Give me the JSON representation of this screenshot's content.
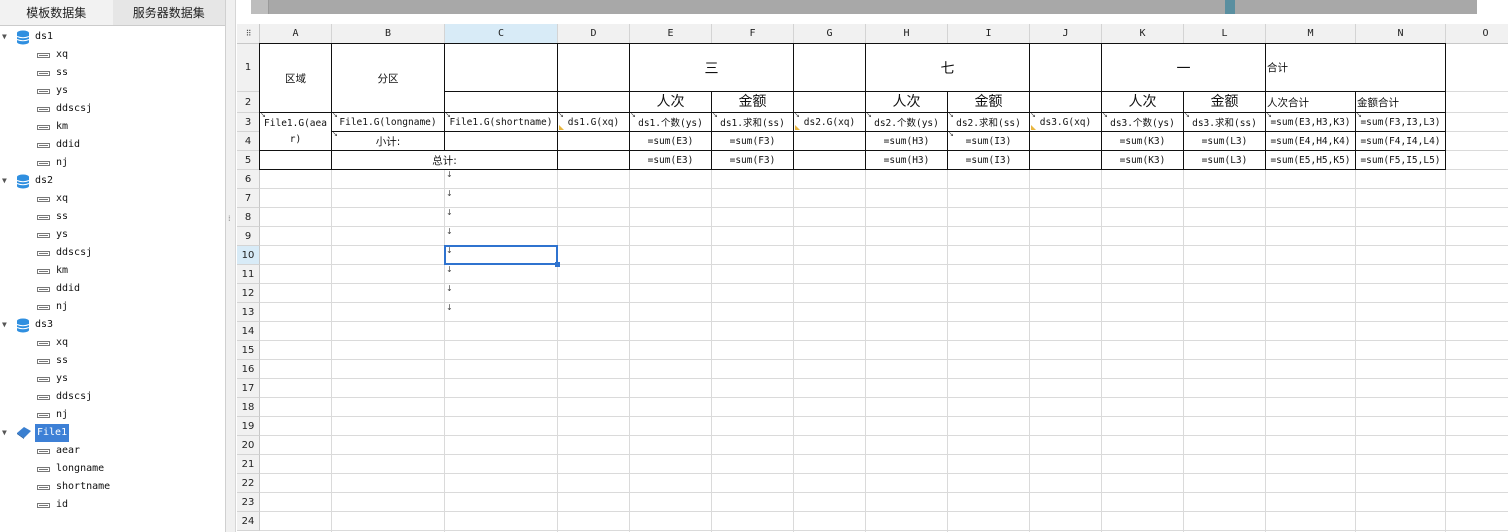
{
  "tabs": {
    "template": "模板数据集",
    "server": "服务器数据集"
  },
  "tree": [
    {
      "name": "ds1",
      "icon": "database-icon",
      "fields": [
        "xq",
        "ss",
        "ys",
        "ddscsj",
        "km",
        "ddid",
        "nj"
      ]
    },
    {
      "name": "ds2",
      "icon": "database-icon",
      "fields": [
        "xq",
        "ss",
        "ys",
        "ddscsj",
        "km",
        "ddid",
        "nj"
      ]
    },
    {
      "name": "ds3",
      "icon": "database-icon",
      "fields": [
        "xq",
        "ss",
        "ys",
        "ddscsj",
        "nj"
      ]
    },
    {
      "name": "File1",
      "icon": "file-dataset-icon",
      "selected": true,
      "fields": [
        "aear",
        "longname",
        "shortname",
        "id"
      ]
    }
  ],
  "columns": [
    "A",
    "B",
    "C",
    "D",
    "E",
    "F",
    "G",
    "H",
    "I",
    "J",
    "K",
    "L",
    "M",
    "N",
    "O"
  ],
  "selected_column": "C",
  "rows": [
    "1",
    "2",
    "3",
    "4",
    "5",
    "6",
    "7",
    "8",
    "9",
    "10",
    "11",
    "12",
    "13",
    "14",
    "15",
    "16",
    "17",
    "18",
    "19",
    "20",
    "21",
    "22",
    "23",
    "24"
  ],
  "selected_row": "10",
  "cells": {
    "A1": "区域",
    "B1": "分区",
    "E1": "三",
    "H1": "七",
    "K1": "一",
    "M1": "合计",
    "E2": "人次",
    "F2": "金额",
    "H2": "人次",
    "I2": "金额",
    "K2": "人次",
    "L2": "金额",
    "M2": "人次合计",
    "N2": "金额合计",
    "A3": "File1.G(aear)",
    "B3": "File1.G(longname)",
    "C3": "File1.G(shortname)",
    "D3": "ds1.G(xq)",
    "E3": "ds1.个数(ys)",
    "F3": "ds1.求和(ss)",
    "G3": "ds2.G(xq)",
    "H3": "ds2.个数(ys)",
    "I3": "ds2.求和(ss)",
    "J3": "ds3.G(xq)",
    "K3": "ds3.个数(ys)",
    "L3": "ds3.求和(ss)",
    "M3": "=sum(E3,H3,K3)",
    "N3": "=sum(F3,I3,L3)",
    "B4": "小计:",
    "E4": "=sum(E3)",
    "F4": "=sum(F3)",
    "H4": "=sum(H3)",
    "I4": "=sum(I3)",
    "K4": "=sum(K3)",
    "L4": "=sum(L3)",
    "M4": "=sum(E4,H4,K4)",
    "N4": "=sum(F4,I4,L4)",
    "B5": "总计:",
    "E5": "=sum(E3)",
    "F5": "=sum(F3)",
    "H5": "=sum(H3)",
    "I5": "=sum(I3)",
    "K5": "=sum(K3)",
    "L5": "=sum(L3)",
    "M5": "=sum(E5,H5,K5)",
    "N5": "=sum(F5,I5,L5)"
  },
  "corner_glyph": "⠿",
  "splitter_glyph": "⁞"
}
